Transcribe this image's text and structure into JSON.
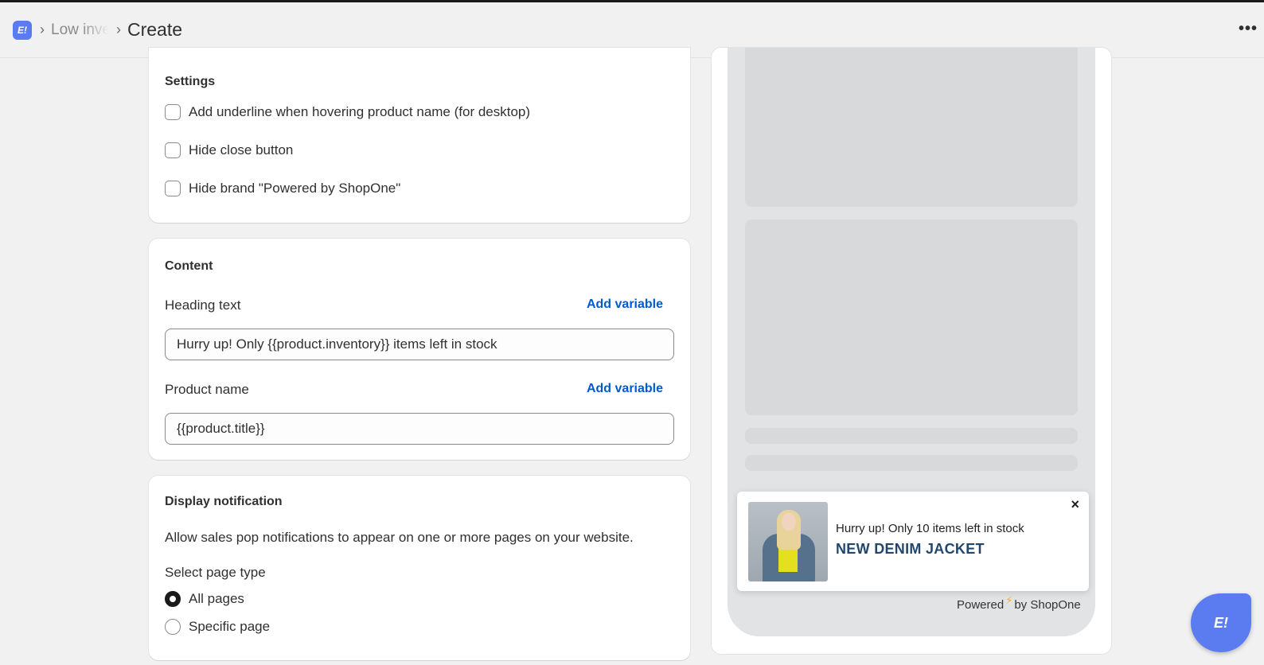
{
  "header": {
    "app_icon": "E!",
    "breadcrumb_link": "Low inventory",
    "breadcrumb_current": "Create",
    "more_icon": "•••"
  },
  "settings": {
    "title": "Settings",
    "options": [
      {
        "label": "Add underline when hovering product name (for desktop)",
        "checked": false
      },
      {
        "label": "Hide close button",
        "checked": false
      },
      {
        "label": "Hide brand \"Powered by ShopOne\"",
        "checked": false
      }
    ]
  },
  "content": {
    "title": "Content",
    "heading_label": "Heading text",
    "heading_add_variable": "Add variable",
    "heading_value": "Hurry up! Only {{product.inventory}} items left in stock",
    "product_label": "Product name",
    "product_add_variable": "Add variable",
    "product_value": "{{product.title}}"
  },
  "display": {
    "title": "Display notification",
    "description": "Allow sales pop notifications to appear on one or more pages on your website.",
    "page_type_label": "Select page type",
    "options": [
      {
        "label": "All pages",
        "selected": true
      },
      {
        "label": "Specific page",
        "selected": false
      }
    ]
  },
  "preview": {
    "popup_heading": "Hurry up! Only 10 items left in stock",
    "popup_product": "NEW DENIM JACKET",
    "popup_close": "×",
    "powered_prefix": "Powered",
    "powered_suffix": "by ShopOne"
  },
  "fab_label": "E!",
  "colors": {
    "accent": "#5b7cf0",
    "link": "#005bd3",
    "product_title": "#22476f"
  }
}
